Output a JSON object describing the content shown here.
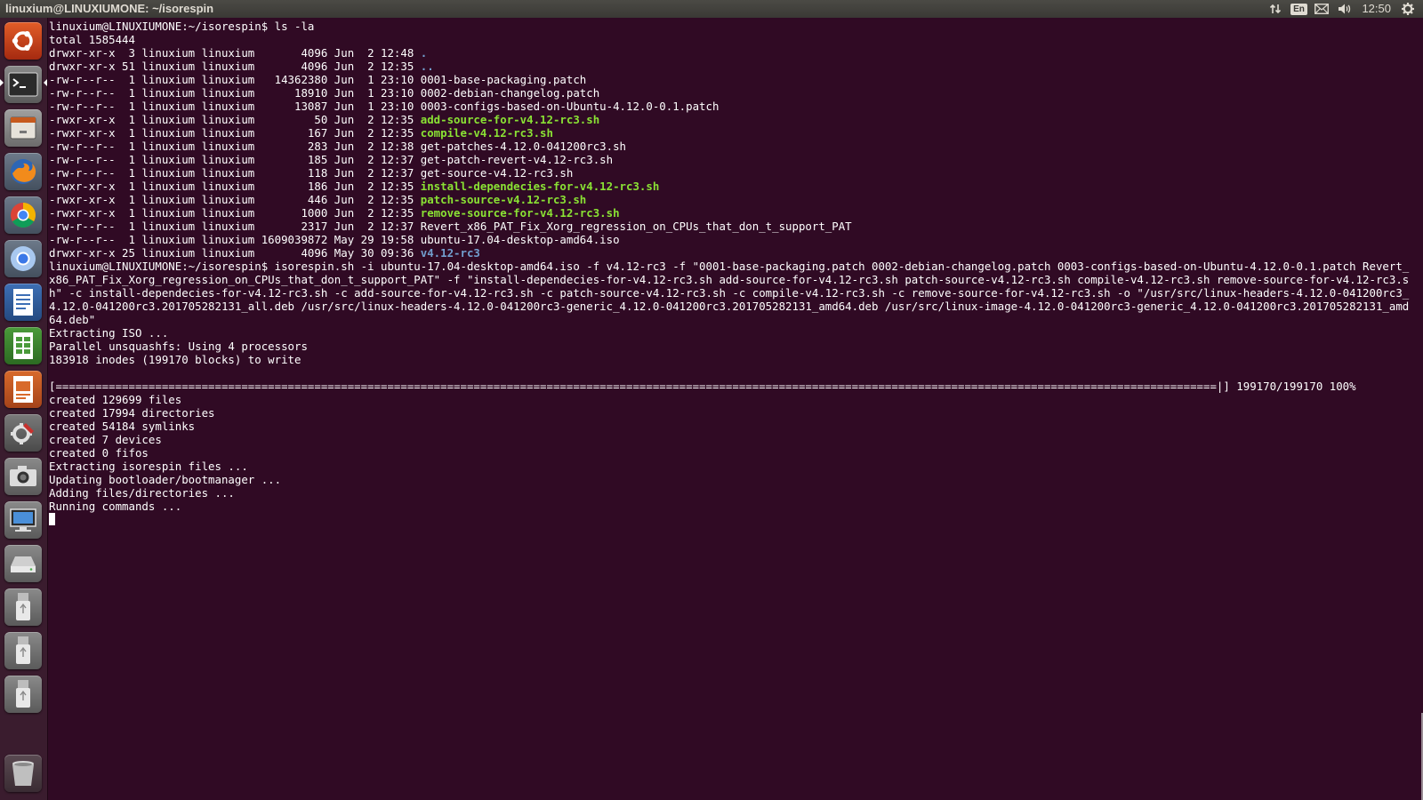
{
  "panel": {
    "window_title": "linuxium@LINUXIUMONE: ~/isorespin",
    "language": "En",
    "clock": "12:50",
    "indicators": [
      "network-arrows-icon",
      "keyboard-language-icon",
      "mail-icon",
      "sound-icon",
      "gear-icon"
    ]
  },
  "launcher": {
    "items": [
      {
        "name": "ubuntu-dash",
        "icon": "ubuntu-logo-icon"
      },
      {
        "name": "terminal",
        "icon": "terminal-icon",
        "running": true
      },
      {
        "name": "files",
        "icon": "files-icon"
      },
      {
        "name": "firefox",
        "icon": "firefox-icon"
      },
      {
        "name": "chrome",
        "icon": "chrome-icon"
      },
      {
        "name": "chromium",
        "icon": "chromium-icon"
      },
      {
        "name": "libreoffice-writer",
        "icon": "writer-icon"
      },
      {
        "name": "libreoffice-calc",
        "icon": "calc-icon"
      },
      {
        "name": "libreoffice-impress",
        "icon": "impress-icon"
      },
      {
        "name": "system-settings",
        "icon": "settings-icon"
      },
      {
        "name": "camera",
        "icon": "camera-icon"
      },
      {
        "name": "remote-desktop",
        "icon": "remote-desktop-icon"
      },
      {
        "name": "drive",
        "icon": "hard-drive-icon"
      },
      {
        "name": "usb-1",
        "icon": "usb-drive-icon"
      },
      {
        "name": "usb-2",
        "icon": "usb-drive-icon"
      },
      {
        "name": "usb-3",
        "icon": "usb-drive-icon"
      },
      {
        "name": "trash",
        "icon": "trash-icon"
      }
    ]
  },
  "terminal": {
    "lines": [
      [
        {
          "t": "linuxium@LINUXIUMONE:~/isorespin$ ls -la"
        }
      ],
      [
        {
          "t": "total 1585444"
        }
      ],
      [
        {
          "t": "drwxr-xr-x  3 linuxium linuxium       4096 Jun  2 12:48 "
        },
        {
          "t": ".",
          "c": "dir"
        }
      ],
      [
        {
          "t": "drwxr-xr-x 51 linuxium linuxium       4096 Jun  2 12:35 "
        },
        {
          "t": "..",
          "c": "dir"
        }
      ],
      [
        {
          "t": "-rw-r--r--  1 linuxium linuxium   14362380 Jun  1 23:10 0001-base-packaging.patch"
        }
      ],
      [
        {
          "t": "-rw-r--r--  1 linuxium linuxium      18910 Jun  1 23:10 0002-debian-changelog.patch"
        }
      ],
      [
        {
          "t": "-rw-r--r--  1 linuxium linuxium      13087 Jun  1 23:10 0003-configs-based-on-Ubuntu-4.12.0-0.1.patch"
        }
      ],
      [
        {
          "t": "-rwxr-xr-x  1 linuxium linuxium         50 Jun  2 12:35 "
        },
        {
          "t": "add-source-for-v4.12-rc3.sh",
          "c": "exe"
        }
      ],
      [
        {
          "t": "-rwxr-xr-x  1 linuxium linuxium        167 Jun  2 12:35 "
        },
        {
          "t": "compile-v4.12-rc3.sh",
          "c": "exe"
        }
      ],
      [
        {
          "t": "-rw-r--r--  1 linuxium linuxium        283 Jun  2 12:38 get-patches-4.12.0-041200rc3.sh"
        }
      ],
      [
        {
          "t": "-rw-r--r--  1 linuxium linuxium        185 Jun  2 12:37 get-patch-revert-v4.12-rc3.sh"
        }
      ],
      [
        {
          "t": "-rw-r--r--  1 linuxium linuxium        118 Jun  2 12:37 get-source-v4.12-rc3.sh"
        }
      ],
      [
        {
          "t": "-rwxr-xr-x  1 linuxium linuxium        186 Jun  2 12:35 "
        },
        {
          "t": "install-dependecies-for-v4.12-rc3.sh",
          "c": "exe"
        }
      ],
      [
        {
          "t": "-rwxr-xr-x  1 linuxium linuxium        446 Jun  2 12:35 "
        },
        {
          "t": "patch-source-v4.12-rc3.sh",
          "c": "exe"
        }
      ],
      [
        {
          "t": "-rwxr-xr-x  1 linuxium linuxium       1000 Jun  2 12:35 "
        },
        {
          "t": "remove-source-for-v4.12-rc3.sh",
          "c": "exe"
        }
      ],
      [
        {
          "t": "-rw-r--r--  1 linuxium linuxium       2317 Jun  2 12:37 Revert_x86_PAT_Fix_Xorg_regression_on_CPUs_that_don_t_support_PAT"
        }
      ],
      [
        {
          "t": "-rw-r--r--  1 linuxium linuxium 1609039872 May 29 19:58 ubuntu-17.04-desktop-amd64.iso"
        }
      ],
      [
        {
          "t": "drwxr-xr-x 25 linuxium linuxium       4096 May 30 09:36 "
        },
        {
          "t": "v4.12-rc3",
          "c": "dir"
        }
      ],
      [
        {
          "t": "linuxium@LINUXIUMONE:~/isorespin$ isorespin.sh -i ubuntu-17.04-desktop-amd64.iso -f v4.12-rc3 -f \"0001-base-packaging.patch 0002-debian-changelog.patch 0003-configs-based-on-Ubuntu-4.12.0-0.1.patch Revert_"
        }
      ],
      [
        {
          "t": "x86_PAT_Fix_Xorg_regression_on_CPUs_that_don_t_support_PAT\" -f \"install-dependecies-for-v4.12-rc3.sh add-source-for-v4.12-rc3.sh patch-source-v4.12-rc3.sh compile-v4.12-rc3.sh remove-source-for-v4.12-rc3.s"
        }
      ],
      [
        {
          "t": "h\" -c install-dependecies-for-v4.12-rc3.sh -c add-source-for-v4.12-rc3.sh -c patch-source-v4.12-rc3.sh -c compile-v4.12-rc3.sh -c remove-source-for-v4.12-rc3.sh -o \"/usr/src/linux-headers-4.12.0-041200rc3_"
        }
      ],
      [
        {
          "t": "4.12.0-041200rc3.201705282131_all.deb /usr/src/linux-headers-4.12.0-041200rc3-generic_4.12.0-041200rc3.201705282131_amd64.deb /usr/src/linux-image-4.12.0-041200rc3-generic_4.12.0-041200rc3.201705282131_amd"
        }
      ],
      [
        {
          "t": "64.deb\""
        }
      ],
      [
        {
          "t": "Extracting ISO ..."
        }
      ],
      [
        {
          "t": "Parallel unsquashfs: Using 4 processors"
        }
      ],
      [
        {
          "t": "183918 inodes (199170 blocks) to write"
        }
      ],
      [
        {
          "t": ""
        }
      ],
      [
        {
          "t": "[===============================================================================================================================================================================|] 199170/199170 100%"
        }
      ],
      [
        {
          "t": "created 129699 files"
        }
      ],
      [
        {
          "t": "created 17994 directories"
        }
      ],
      [
        {
          "t": "created 54184 symlinks"
        }
      ],
      [
        {
          "t": "created 7 devices"
        }
      ],
      [
        {
          "t": "created 0 fifos"
        }
      ],
      [
        {
          "t": "Extracting isorespin files ..."
        }
      ],
      [
        {
          "t": "Updating bootloader/bootmanager ..."
        }
      ],
      [
        {
          "t": "Adding files/directories ..."
        }
      ],
      [
        {
          "t": "Running commands ..."
        }
      ]
    ]
  }
}
